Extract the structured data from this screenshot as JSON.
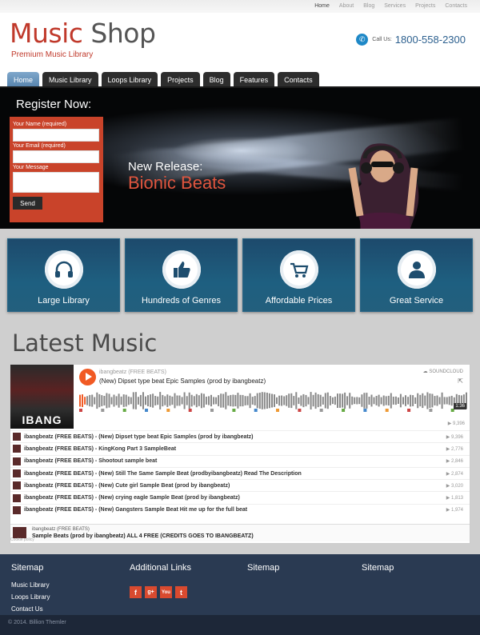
{
  "toplinks": [
    "Home",
    "About",
    "Blog",
    "Services",
    "Projects",
    "Contacts"
  ],
  "header": {
    "logo_part1": "Music",
    "logo_part2": " Shop",
    "tagline": "Premium Music Library",
    "call_label": "Call Us:",
    "phone": "1800-558-2300"
  },
  "nav": [
    "Home",
    "Music Library",
    "Loops Library",
    "Projects",
    "Blog",
    "Features",
    "Contacts"
  ],
  "hero": {
    "register_title": "Register Now:",
    "name_label": "Your Name (required)",
    "email_label": "Your Email (required)",
    "message_label": "Your Message",
    "send_label": "Send",
    "release_line1": "New Release:",
    "release_line2": "Bionic Beats"
  },
  "features": [
    "Large Library",
    "Hundreds of Genres",
    "Affordable Prices",
    "Great Service"
  ],
  "latest_title": "Latest Music",
  "player": {
    "artist": "ibangbeatz (FREE BEATS)",
    "title": "(New) Dipset type beat Epic Samples (prod by ibangbeatz)",
    "brand": "SOUNDCLOUD",
    "duration": "1:36",
    "plays": "9,396",
    "art_text": "IBANG",
    "tracks": [
      {
        "title": "ibangbeatz (FREE BEATS) - (New) Dipset type beat Epic Samples (prod by ibangbeatz)",
        "plays": "9,396"
      },
      {
        "title": "ibangbeatz (FREE BEATS) - KingKong Part 3 SampleBeat",
        "plays": "2,776"
      },
      {
        "title": "ibangbeatz (FREE BEATS) - Shootout sample beat",
        "plays": "2,846"
      },
      {
        "title": "ibangbeatz (FREE BEATS) - (New) Still The Same Sample Beat (prodbyibangbeatz) Read The Description",
        "plays": "2,874"
      },
      {
        "title": "ibangbeatz (FREE BEATS) - (New) Cute girl Sample Beat (prod by ibangbeatz)",
        "plays": "3,020"
      },
      {
        "title": "ibangbeatz (FREE BEATS) - (New) crying eagle Sample Beat (prod by ibangbeatz)",
        "plays": "1,813"
      },
      {
        "title": "ibangbeatz (FREE BEATS) - (New) Gangsters Sample Beat Hit me up for the full beat",
        "plays": "1,974"
      }
    ],
    "bottom_artist": "ibangbeatz (FREE BEATS)",
    "bottom_title": "Sample Beats (prod by ibangbeatz) ALL 4 FREE (CREDITS GOES TO IBANGBEATZ)",
    "cookie": "Cookie policy"
  },
  "footer": {
    "col1_title": "Sitemap",
    "col1_links": [
      "Music Library",
      "Loops Library",
      "Contact Us"
    ],
    "col2_title": "Additional Links",
    "col3_title": "Sitemap",
    "col4_title": "Sitemap",
    "social": [
      "f",
      "g+",
      "You",
      "t"
    ],
    "copyright": "© 2014. Billion Themler"
  },
  "colors": {
    "accent": "#c0392b",
    "nav_active": "#5582ac",
    "feature_bg": "#1e5f80",
    "footer_bg": "#2a3a52",
    "soundcloud": "#f15a24"
  }
}
